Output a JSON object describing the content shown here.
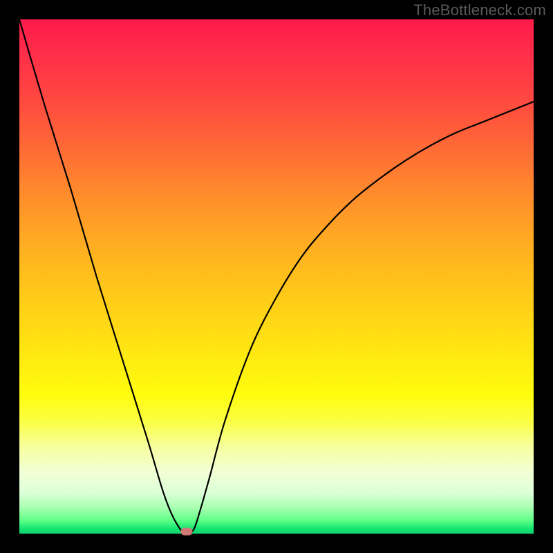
{
  "watermark": "TheBottleneck.com",
  "chart_data": {
    "type": "line",
    "title": "",
    "xlabel": "",
    "ylabel": "",
    "x_range": [
      0,
      100
    ],
    "y_range": [
      0,
      100
    ],
    "series": [
      {
        "name": "bottleneck-curve",
        "x": [
          0,
          5,
          10,
          15,
          20,
          25,
          28,
          30,
          32,
          33,
          34,
          35,
          37,
          40,
          45,
          50,
          55,
          60,
          65,
          70,
          75,
          80,
          85,
          90,
          95,
          100
        ],
        "values": [
          100,
          83,
          67,
          50,
          34,
          18,
          8,
          3,
          0,
          0,
          1,
          4,
          11,
          22,
          36,
          46,
          54,
          60,
          65,
          69,
          72.5,
          75.5,
          78,
          80,
          82,
          84
        ]
      }
    ],
    "minimum_point": {
      "x": 32.5,
      "y": 0
    },
    "background_gradient": {
      "top": "#ff1a4b",
      "bottom": "#0fd06f",
      "description": "red-orange-yellow-green vertical gradient"
    }
  }
}
